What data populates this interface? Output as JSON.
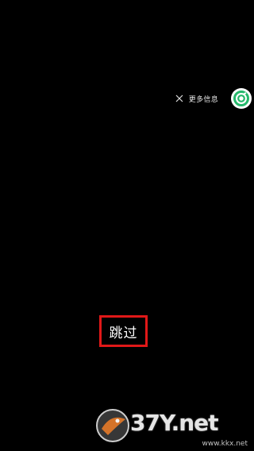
{
  "top_bar": {
    "close_icon": "close-icon",
    "more_info_label": "更多信息",
    "badge_icon": "app-logo-icon",
    "badge_color": "#25b86c"
  },
  "main": {
    "skip_label": "跳过",
    "highlight_color": "#e01818"
  },
  "watermark": {
    "logo_text": "37Y.net",
    "url_text": "www.kkx.net"
  }
}
